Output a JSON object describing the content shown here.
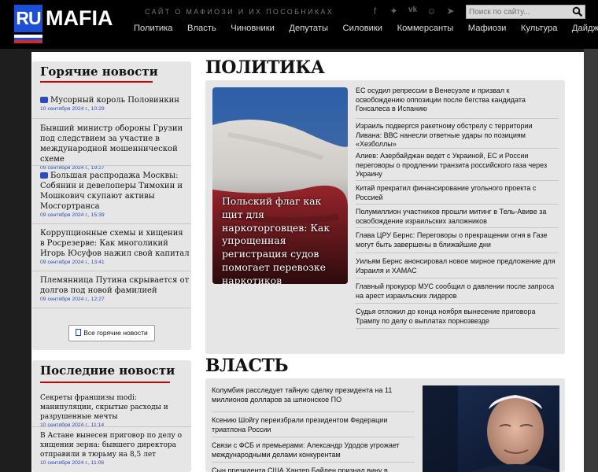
{
  "header": {
    "logo_ru": "RU",
    "logo_mafia": "MAFIA",
    "tagline": "САЙТ О МАФИОЗИ И ИХ ПОСОБНИКАХ",
    "search_placeholder": "Поиск по сайту...",
    "nav": [
      "Политика",
      "Власть",
      "Чиновники",
      "Депутаты",
      "Силовики",
      "Коммерсанты",
      "Мафиози",
      "Культура",
      "Дайджест"
    ],
    "social_icons": [
      "facebook-icon",
      "twitter-icon",
      "vk-icon",
      "odnoklassniki-icon",
      "telegram-icon",
      "mobile-icon"
    ],
    "colors": {
      "ru_blue": "#1b4fd8",
      "flag_white": "#ffffff",
      "flag_blue": "#1b4fd8",
      "flag_red": "#d52b1e",
      "accent_red": "#cc0000",
      "date_blue": "#2b4bbf"
    }
  },
  "hot": {
    "title": "Горячие новости",
    "items": [
      {
        "title": "Мусорный король Половинкин",
        "date": "10 сентября 2024 г., 10:29",
        "video": true
      },
      {
        "title": "Бывший министр обороны Грузии под следствием за участие в международной мошеннической схеме",
        "date": "09 сентября 2024 г., 19:27",
        "video": false
      },
      {
        "title": "Большая распродажа Москвы: Собянин и девелоперы Тимохин и Мошкович скупают активы Мосгортранса",
        "date": "09 сентября 2024 г., 15:39",
        "video": true
      },
      {
        "title": "Коррупционные схемы и хищения в Росрезерве: Как многоликий Игорь Юсуфов нажил свой капитал",
        "date": "09 сентября 2024 г., 13:41",
        "video": false
      },
      {
        "title": "Племянница Путина скрывается от долгов под новой фамилией",
        "date": "09 сентября 2024 г., 12:27",
        "video": false
      }
    ],
    "all_label": "Все горячие новости"
  },
  "latest": {
    "title": "Последние новости",
    "items": [
      {
        "title": "Секреты франшизы modi: манипуляции, скрытые расходы и разрушенные мечты",
        "date": "10 сентября 2024 г., 11:14"
      },
      {
        "title": "В Астане вынесен приговор по делу о хищении зерна: бывшего директора отправили в тюрьму на 8,5 лет",
        "date": "10 сентября 2024 г., 11:06"
      }
    ]
  },
  "politics": {
    "title": "ПОЛИТИКА",
    "feature_title": "Польский флаг как щит для наркоторговцев: Как упрощенная регистрация судов помогает перевозке наркотиков",
    "news": [
      "ЕС осудил репрессии в Венесуэле и призвал к освобождению оппозиции после бегства кандидата Гонсалеса в Испанию",
      "Израиль подвергся ракетному обстрелу с территории Ливана: ВВС нанесли ответные удары по позициям «Хезболлы»",
      "Алиев: Азербайджан ведет с Украиной, ЕС и России переговоры о продлении транзита российского газа через Украину",
      "Китай прекратил финансирование угольного проекта с Россией",
      "Полумиллион участников прошли митинг в Тель-Авиве за освобождение израильских заложников",
      "Глава ЦРУ Бернс: Переговоры о прекращении огня в Газе могут быть завершены в ближайшие дни",
      "Уильям Бернс анонсировал новое мирное предложение для Израиля и ХАМАС",
      "Главный прокурор МУС сообщил о давлении после запроса на арест израильских лидеров",
      "Судья отложил до конца ноября вынесение приговора Трампу по делу о выплатах порнозвезде"
    ]
  },
  "vlast": {
    "title": "ВЛАСТЬ",
    "news": [
      "Колумбия расследует тайную сделку президента на 11 миллионов долларов за шпионское ПО",
      "Ксению Шойгу переизбрали президентом Федерации триатлона России",
      "Связи с ФСБ и премьерами: Александр Удодов угрожает международными делами конкурентам",
      "Сын президента США Хантер Байден признал вину в"
    ]
  }
}
